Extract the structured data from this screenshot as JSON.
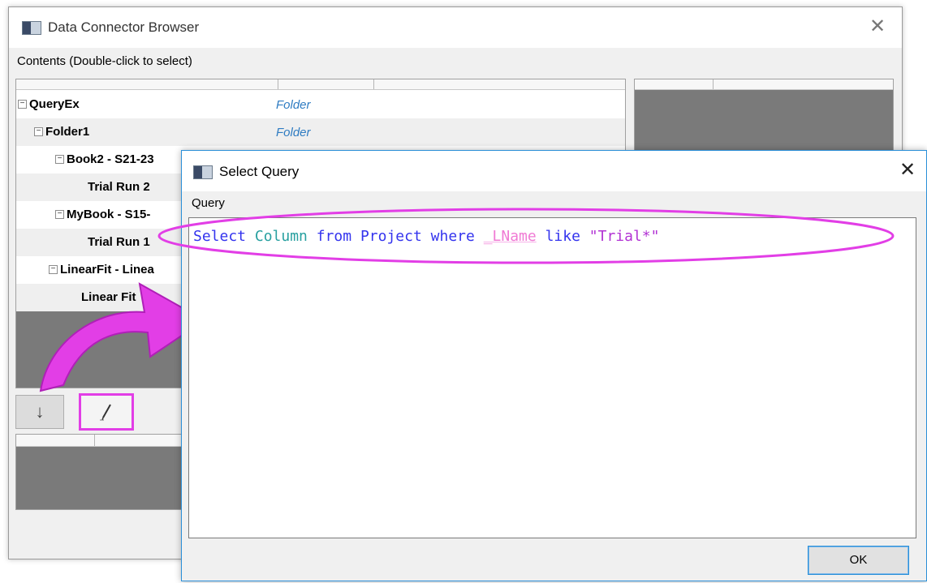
{
  "main_window": {
    "title": "Data Connector Browser",
    "close_glyph": "✕",
    "contents_label": "Contents (Double-click to select)",
    "tree": [
      {
        "label": "QueryEx",
        "type": "Folder",
        "expander": "⊟"
      },
      {
        "label": "Folder1",
        "type": "Folder",
        "expander": "⊟"
      },
      {
        "label": "Book2 - S21-23",
        "type": "",
        "expander": "⊟"
      },
      {
        "label": "Trial Run 2",
        "type": "",
        "expander": ""
      },
      {
        "label": "MyBook - S15-",
        "type": "",
        "expander": "⊟"
      },
      {
        "label": "Trial Run 1",
        "type": "",
        "expander": ""
      },
      {
        "label": "LinearFit - Linea",
        "type": "",
        "expander": "⊟"
      },
      {
        "label": "Linear Fit",
        "type": "",
        "expander": ""
      }
    ],
    "toolbar": {
      "import_icon": "↓",
      "edit_icon": "pencil-icon"
    }
  },
  "dialog": {
    "title": "Select Query",
    "close_glyph": "✕",
    "query_label": "Query",
    "query": {
      "select": "Select",
      "column": "Column",
      "from": "from",
      "project": "Project",
      "where": "where",
      "field": "_LName",
      "like": "like",
      "pattern": "\"Trial*\""
    },
    "ok_label": "OK"
  },
  "colors": {
    "highlight_magenta": "#e23ee6",
    "folder_type": "#2f7cc2",
    "keyword_blue": "#3434ee",
    "keyword_teal": "#28a0a0",
    "field_pink": "#f07ad4",
    "string_purple": "#b233d4"
  }
}
